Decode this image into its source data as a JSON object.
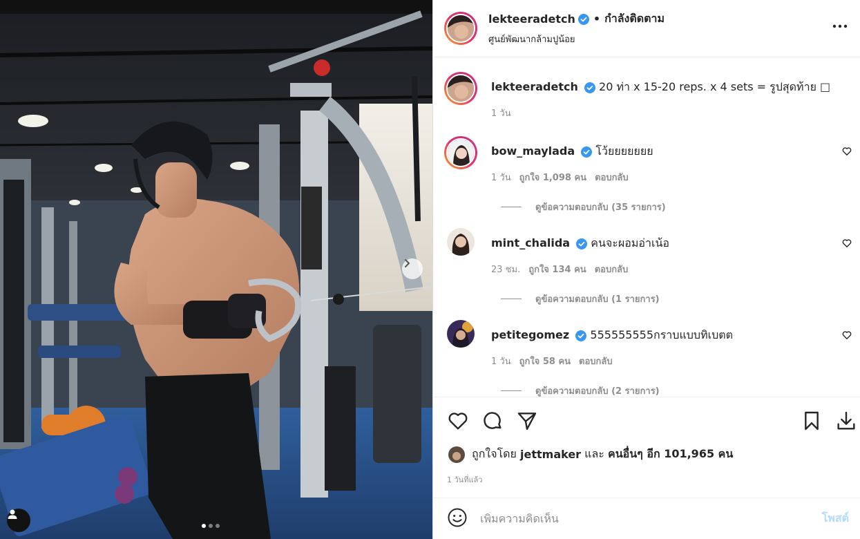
{
  "post": {
    "username": "lekteeradetch",
    "follow_status": "กำลังติดตาม",
    "separator": "•",
    "location": "ศูนย์พัฒนากล้ามปูน้อย",
    "caption": "20 ท่า x 15-20 reps. x 4 sets = รูปสุดท้าย □",
    "caption_time": "1 วัน"
  },
  "comments": [
    {
      "username": "bow_maylada",
      "text": "โว้ยยยยยยย",
      "time": "1 วัน",
      "likes": "ถูกใจ 1,098 คน",
      "reply": "ตอบกลับ",
      "view_replies": "ดูข้อความตอบกลับ (35 รายการ)"
    },
    {
      "username": "mint_chalida",
      "text": "คนจะผอมอ่าเน้อ",
      "time": "23 ชม.",
      "likes": "ถูกใจ 134 คน",
      "reply": "ตอบกลับ",
      "view_replies": "ดูข้อความตอบกลับ (1 รายการ)"
    },
    {
      "username": "petitegomez",
      "text": "555555555กราบแบบทิเบตต",
      "time": "1 วัน",
      "likes": "ถูกใจ 58 คน",
      "reply": "ตอบกลับ",
      "view_replies": "ดูข้อความตอบกลับ (2 รายการ)"
    }
  ],
  "likes_line": {
    "prefix": "ถูกใจโดย",
    "user": "jettmaker",
    "and": "และ",
    "others": "คนอื่นๆ อีก 101,965 คน"
  },
  "time_ago": "1 วันที่แล้ว",
  "add_comment": {
    "placeholder": "เพิ่มความคิดเห็น",
    "post_label": "โพสต์"
  },
  "colors": {
    "verified": "#3897f0",
    "post_disabled": "#b3dbff",
    "muted": "#8e8e8e"
  },
  "carousel": {
    "slides": 3,
    "active_index": 0
  }
}
